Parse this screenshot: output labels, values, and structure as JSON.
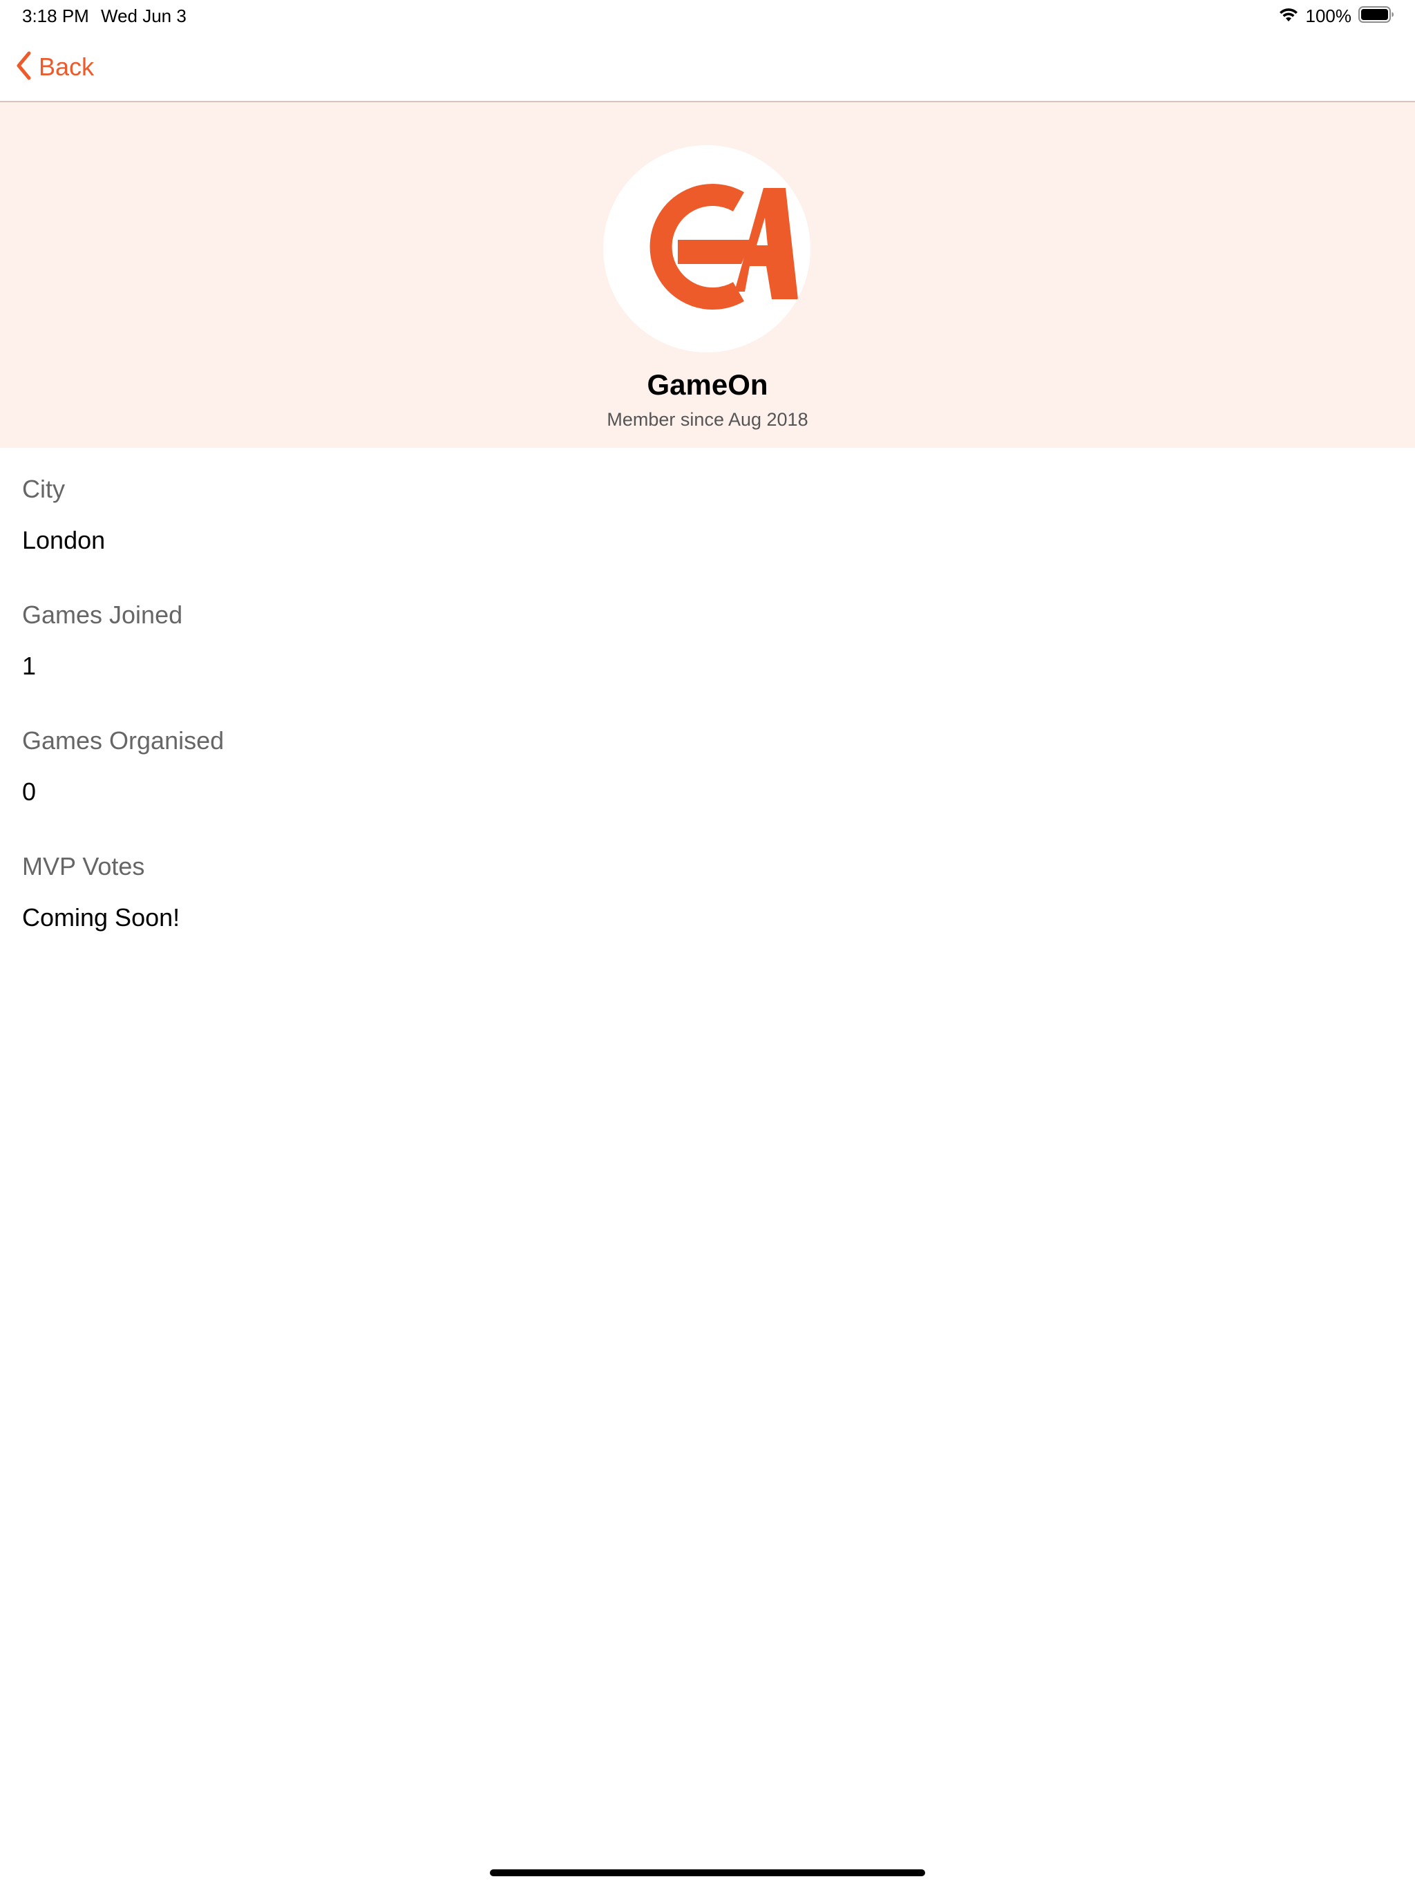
{
  "status_bar": {
    "time": "3:18 PM",
    "date": "Wed Jun 3",
    "battery": "100%",
    "icons": [
      "wifi-icon",
      "battery-icon"
    ]
  },
  "nav": {
    "back_label": "Back",
    "icon": "chevron-left-icon"
  },
  "profile": {
    "avatar_logo": "GA",
    "name": "GameOn",
    "member_since": "Member since Aug 2018"
  },
  "details": [
    {
      "label": "City",
      "value": "London"
    },
    {
      "label": "Games Joined",
      "value": "1"
    },
    {
      "label": "Games Organised",
      "value": "0"
    },
    {
      "label": "MVP Votes",
      "value": "Coming Soon!"
    }
  ],
  "colors": {
    "accent": "#ee5b2b",
    "header_bg": "#fef0ea"
  }
}
